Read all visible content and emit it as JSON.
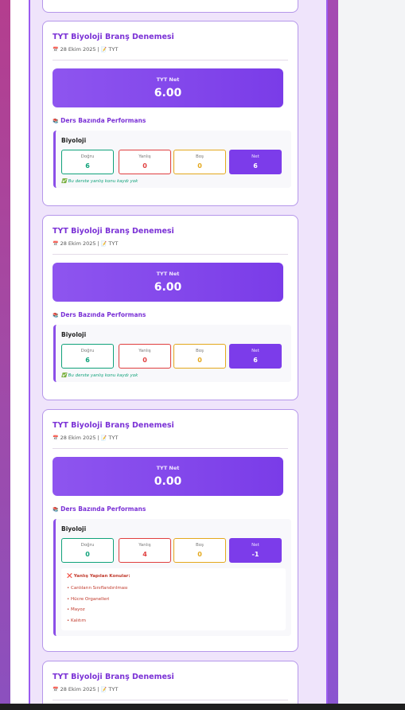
{
  "cards": [
    {
      "title": "TYT Biyoloji Branş Denemesi",
      "date": "28 Ekim 2025",
      "exam_type": "TYT",
      "net_label": "TYT Net",
      "net_value": "6.00",
      "performance_title": "Ders Bazında Performans",
      "subject": "Biyoloji",
      "dogru_label": "Doğru",
      "dogru": "6",
      "yanlis_label": "Yanlış",
      "yanlis": "0",
      "bos_label": "Boş",
      "bos": "0",
      "net_short_label": "Net",
      "net": "6",
      "no_wrong_text": "Bu derste yanlış konu kaydı yok"
    },
    {
      "title": "TYT Biyoloji Branş Denemesi",
      "date": "28 Ekim 2025",
      "exam_type": "TYT",
      "net_label": "TYT Net",
      "net_value": "6.00",
      "performance_title": "Ders Bazında Performans",
      "subject": "Biyoloji",
      "dogru_label": "Doğru",
      "dogru": "6",
      "yanlis_label": "Yanlış",
      "yanlis": "0",
      "bos_label": "Boş",
      "bos": "0",
      "net_short_label": "Net",
      "net": "6",
      "no_wrong_text": "Bu derste yanlış konu kaydı yok"
    },
    {
      "title": "TYT Biyoloji Branş Denemesi",
      "date": "28 Ekim 2025",
      "exam_type": "TYT",
      "net_label": "TYT Net",
      "net_value": "0.00",
      "performance_title": "Ders Bazında Performans",
      "subject": "Biyoloji",
      "dogru_label": "Doğru",
      "dogru": "0",
      "yanlis_label": "Yanlış",
      "yanlis": "4",
      "bos_label": "Boş",
      "bos": "0",
      "net_short_label": "Net",
      "net": "-1",
      "wrong_topics_title": "Yanlış Yapılan Konular:",
      "wrong_topics": [
        "Canlıların Sınıflandırılması",
        "Hücre Organelleri",
        "Mayoz",
        "Kalıtım"
      ]
    },
    {
      "title": "TYT Biyoloji Branş Denemesi",
      "date": "28 Ekim 2025",
      "exam_type": "TYT"
    }
  ],
  "colors": {
    "accent": "#7b32d6",
    "net_gradient_start": "#8e55ef",
    "net_gradient_end": "#7a3ce8",
    "dogru": "#10a27a",
    "yanlis": "#e03f3f",
    "bos": "#e4a81c"
  }
}
